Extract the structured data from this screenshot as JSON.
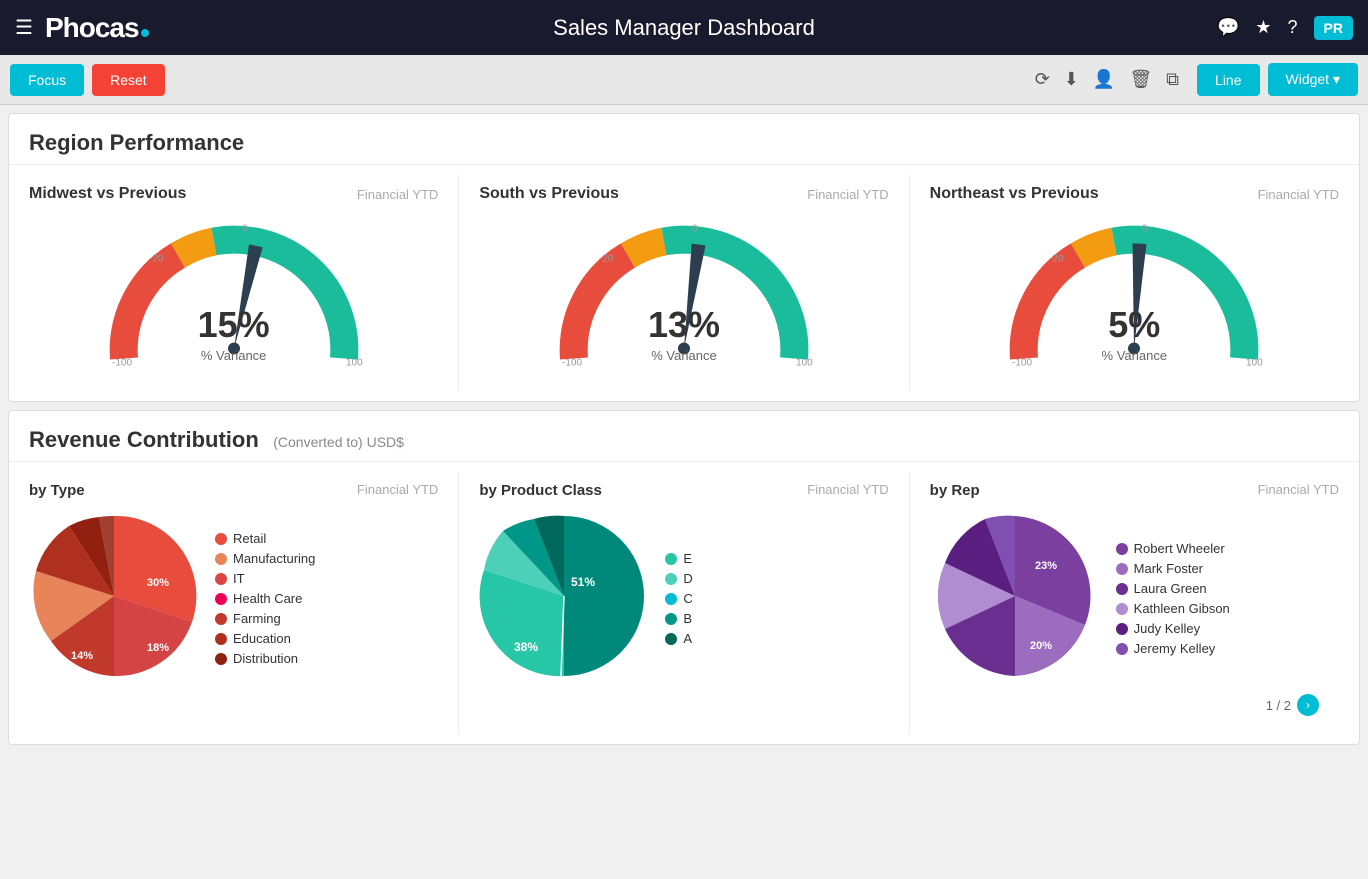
{
  "header": {
    "menu_icon": "☰",
    "logo": "Phocas",
    "title": "Sales Manager Dashboard",
    "icons": [
      "💬",
      "★",
      "?"
    ],
    "avatar": "PR"
  },
  "toolbar": {
    "focus_label": "Focus",
    "reset_label": "Reset",
    "line_label": "Line",
    "widget_label": "Widget ▾"
  },
  "region_performance": {
    "title": "Region Performance",
    "gauges": [
      {
        "title": "Midwest vs Previous",
        "period": "Financial YTD",
        "value": "15%",
        "label": "% Variance"
      },
      {
        "title": "South vs Previous",
        "period": "Financial YTD",
        "value": "13%",
        "label": "% Variance"
      },
      {
        "title": "Northeast vs Previous",
        "period": "Financial YTD",
        "value": "5%",
        "label": "% Variance"
      }
    ]
  },
  "revenue_contribution": {
    "title": "Revenue Contribution",
    "subtitle": "(Converted to) USD$",
    "by_type": {
      "title": "by Type",
      "period": "Financial YTD",
      "legend": [
        {
          "label": "Retail",
          "color": "#e74c3c"
        },
        {
          "label": "Manufacturing",
          "color": "#e8845a"
        },
        {
          "label": "IT",
          "color": "#d44"
        },
        {
          "label": "Health Care",
          "color": "#e05"
        },
        {
          "label": "Farming",
          "color": "#c0392b"
        },
        {
          "label": "Education",
          "color": "#b03020"
        },
        {
          "label": "Distribution",
          "color": "#922010"
        }
      ],
      "slices": [
        {
          "label": "30%",
          "value": 30,
          "color": "#e74c3c"
        },
        {
          "label": "18%",
          "value": 18,
          "color": "#d44444"
        },
        {
          "label": "14%",
          "value": 14,
          "color": "#c0392b"
        },
        {
          "label": "12%",
          "value": 12,
          "color": "#e8845a"
        },
        {
          "label": "10%",
          "value": 10,
          "color": "#b03020"
        },
        {
          "label": "9%",
          "value": 9,
          "color": "#922010"
        },
        {
          "label": "7%",
          "value": 7,
          "color": "#a04030"
        }
      ]
    },
    "by_product_class": {
      "title": "by Product Class",
      "period": "Financial YTD",
      "legend": [
        {
          "label": "E",
          "color": "#26c6a6"
        },
        {
          "label": "D",
          "color": "#4dd0b8"
        },
        {
          "label": "C",
          "color": "#00bcd4"
        },
        {
          "label": "B",
          "color": "#009688"
        },
        {
          "label": "A",
          "color": "#00695c"
        }
      ],
      "values": [
        {
          "label": "38%",
          "value": 38,
          "color": "#26c6a6"
        },
        {
          "label": "51%",
          "value": 51,
          "color": "#00897b"
        },
        {
          "label": "6%",
          "value": 6,
          "color": "#4dd0b8"
        },
        {
          "label": "3%",
          "value": 3,
          "color": "#009688"
        },
        {
          "label": "2%",
          "value": 2,
          "color": "#00695c"
        }
      ]
    },
    "by_rep": {
      "title": "by Rep",
      "period": "Financial YTD",
      "legend": [
        {
          "label": "Robert Wheeler",
          "color": "#7b3fa0"
        },
        {
          "label": "Mark Foster",
          "color": "#9c6cbf"
        },
        {
          "label": "Laura Green",
          "color": "#6a2d90"
        },
        {
          "label": "Kathleen Gibson",
          "color": "#b08cd0"
        },
        {
          "label": "Judy Kelley",
          "color": "#5a1d80"
        },
        {
          "label": "Jeremy Kelley",
          "color": "#8050b0"
        }
      ],
      "values": [
        {
          "label": "23%",
          "value": 23,
          "color": "#7b3fa0"
        },
        {
          "label": "20%",
          "value": 20,
          "color": "#9c6cbf"
        },
        {
          "label": "18%",
          "value": 18,
          "color": "#6a2d90"
        },
        {
          "label": "15%",
          "value": 15,
          "color": "#b08cd0"
        },
        {
          "label": "13%",
          "value": 13,
          "color": "#5a1d80"
        },
        {
          "label": "11%",
          "value": 11,
          "color": "#8050b0"
        }
      ]
    },
    "pagination": "1 / 2"
  }
}
